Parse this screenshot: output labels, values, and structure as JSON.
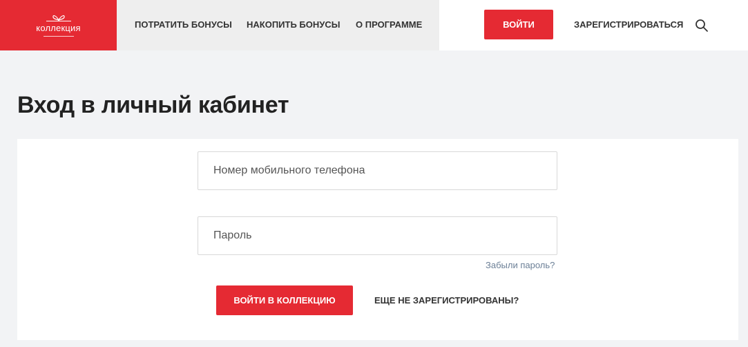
{
  "header": {
    "logo_text": "коллекция",
    "nav": [
      {
        "label": "ПОТРАТИТЬ БОНУСЫ"
      },
      {
        "label": "НАКОПИТЬ БОНУСЫ"
      },
      {
        "label": "О ПРОГРАММЕ"
      }
    ],
    "login_label": "ВОЙТИ",
    "register_label": "ЗАРЕГИСТРИРОВАТЬСЯ",
    "search_icon": "search-icon"
  },
  "page": {
    "title": "Вход в личный кабинет"
  },
  "form": {
    "phone_placeholder": "Номер мобильного телефона",
    "password_placeholder": "Пароль",
    "forgot_label": "Забыли пароль?",
    "submit_label": "ВОЙТИ В КОЛЛЕКЦИЮ",
    "not_registered_label": "ЕЩЕ НЕ ЗАРЕГИСТРИРОВАНЫ?"
  },
  "colors": {
    "brand_red": "#e52a33",
    "link_gray_blue": "#6b7f96",
    "page_bg": "#f2f3f5"
  }
}
